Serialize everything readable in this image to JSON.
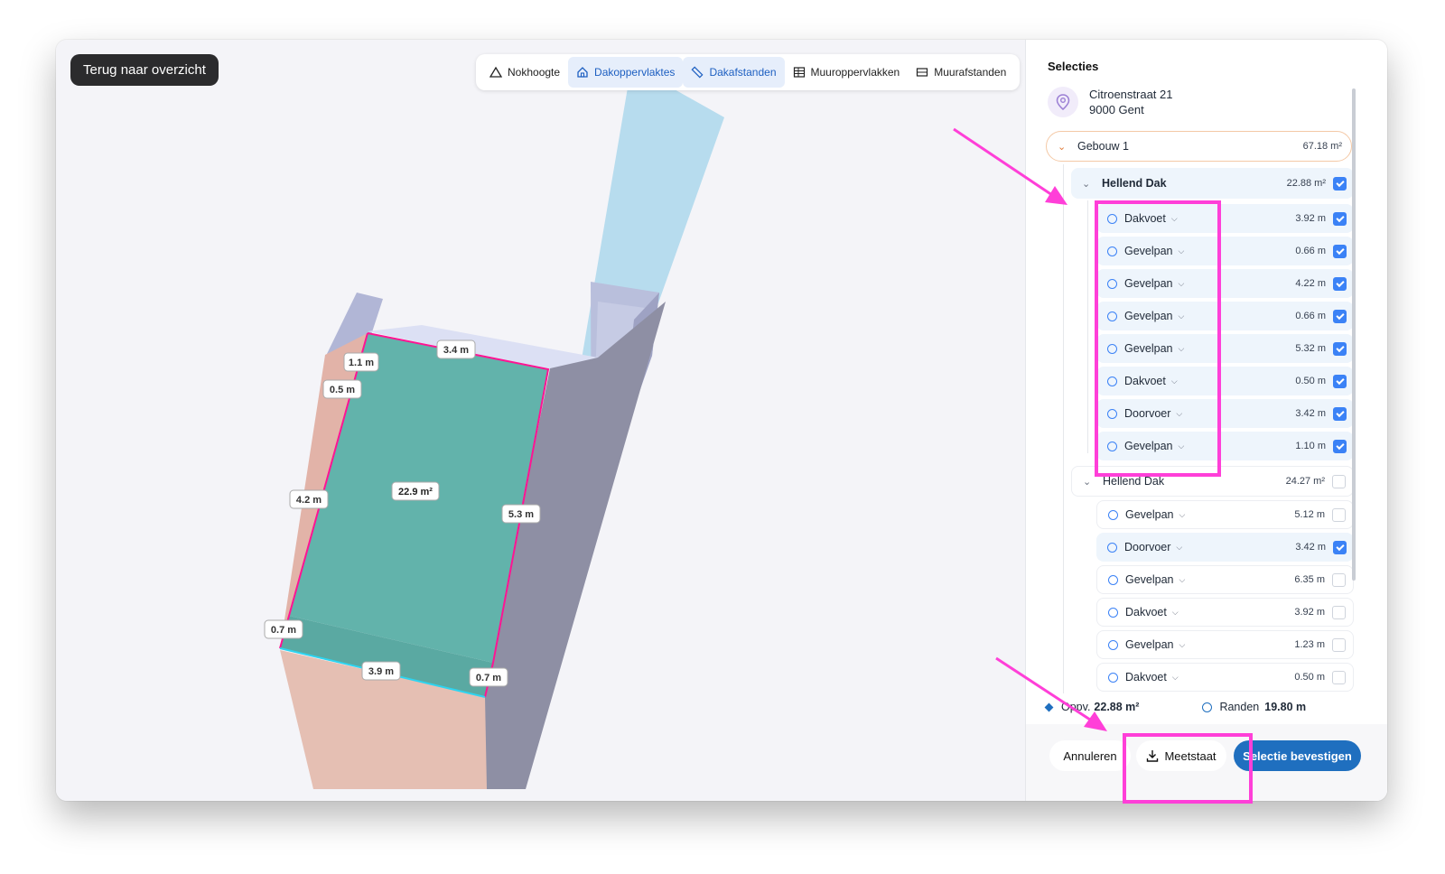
{
  "back_label": "Terug naar overzicht",
  "toolbar": [
    {
      "label": "Nokhoogte",
      "icon": "triangle-icon",
      "active": false
    },
    {
      "label": "Dakoppervlaktes",
      "icon": "house-icon",
      "active": true
    },
    {
      "label": "Dakafstanden",
      "icon": "ruler-icon",
      "active": true
    },
    {
      "label": "Muuroppervlakken",
      "icon": "wall-grid-icon",
      "active": false
    },
    {
      "label": "Muurafstanden",
      "icon": "wall-distance-icon",
      "active": false
    }
  ],
  "scene_labels": {
    "top": "3.4 m",
    "a": "1.1 m",
    "b": "0.5 m",
    "left": "4.2 m",
    "area": "22.9 m²",
    "right": "5.3 m",
    "bl": "0.7 m",
    "bottom": "3.9 m",
    "br": "0.7 m"
  },
  "panel": {
    "title": "Selecties",
    "address_line1": "Citroenstraat 21",
    "address_line2": "9000 Gent",
    "building": {
      "label": "Gebouw 1",
      "value": "67.18 m²"
    },
    "groups": [
      {
        "label": "Hellend Dak",
        "value": "22.88 m²",
        "checked": true,
        "items": [
          {
            "label": "Dakvoet",
            "value": "3.92 m",
            "checked": true
          },
          {
            "label": "Gevelpan",
            "value": "0.66 m",
            "checked": true
          },
          {
            "label": "Gevelpan",
            "value": "4.22 m",
            "checked": true
          },
          {
            "label": "Gevelpan",
            "value": "0.66 m",
            "checked": true
          },
          {
            "label": "Gevelpan",
            "value": "5.32 m",
            "checked": true
          },
          {
            "label": "Dakvoet",
            "value": "0.50 m",
            "checked": true
          },
          {
            "label": "Doorvoer",
            "value": "3.42 m",
            "checked": true
          },
          {
            "label": "Gevelpan",
            "value": "1.10 m",
            "checked": true
          }
        ]
      },
      {
        "label": "Hellend Dak",
        "value": "24.27 m²",
        "checked": false,
        "items": [
          {
            "label": "Gevelpan",
            "value": "5.12 m",
            "checked": false
          },
          {
            "label": "Doorvoer",
            "value": "3.42 m",
            "checked": true
          },
          {
            "label": "Gevelpan",
            "value": "6.35 m",
            "checked": false
          },
          {
            "label": "Dakvoet",
            "value": "3.92 m",
            "checked": false
          },
          {
            "label": "Gevelpan",
            "value": "1.23 m",
            "checked": false
          },
          {
            "label": "Dakvoet",
            "value": "0.50 m",
            "checked": false
          }
        ]
      }
    ],
    "stats": {
      "area_label": "Oppv.",
      "area_value": "22.88 m²",
      "edges_label": "Randen",
      "edges_value": "19.80 m"
    },
    "buttons": {
      "cancel": "Annuleren",
      "meetstaat": "Meetstaat",
      "confirm": "Selectie bevestigen"
    }
  },
  "colors": {
    "accent": "#1f6fbf",
    "highlight": "#ff3fd8",
    "roof_face": "#62b3ab",
    "selected_row": "#eef5fc"
  }
}
